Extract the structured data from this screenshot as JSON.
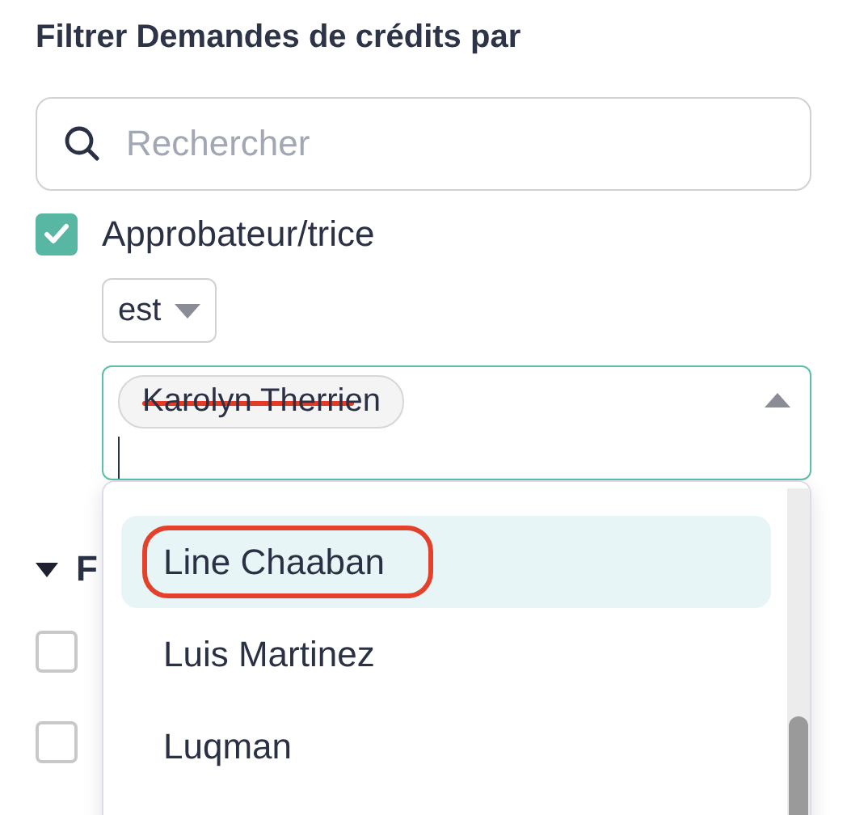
{
  "heading": "Filtrer Demandes de crédits par",
  "search": {
    "placeholder": "Rechercher"
  },
  "filter": {
    "label": "Approbateur/trice",
    "checked": true,
    "operator": "est",
    "expanded": true,
    "chips": [
      {
        "label": "Karolyn Therrien",
        "struck": true
      }
    ],
    "options": [
      {
        "label": "Line Chaaban",
        "selected": true,
        "circled": true
      },
      {
        "label": "Luis Martinez",
        "selected": false,
        "circled": false
      },
      {
        "label": "Luqman",
        "selected": false,
        "circled": false
      }
    ]
  },
  "section": {
    "title": "F",
    "expanded": true,
    "items": [
      {
        "checked": false
      },
      {
        "checked": false
      }
    ]
  }
}
